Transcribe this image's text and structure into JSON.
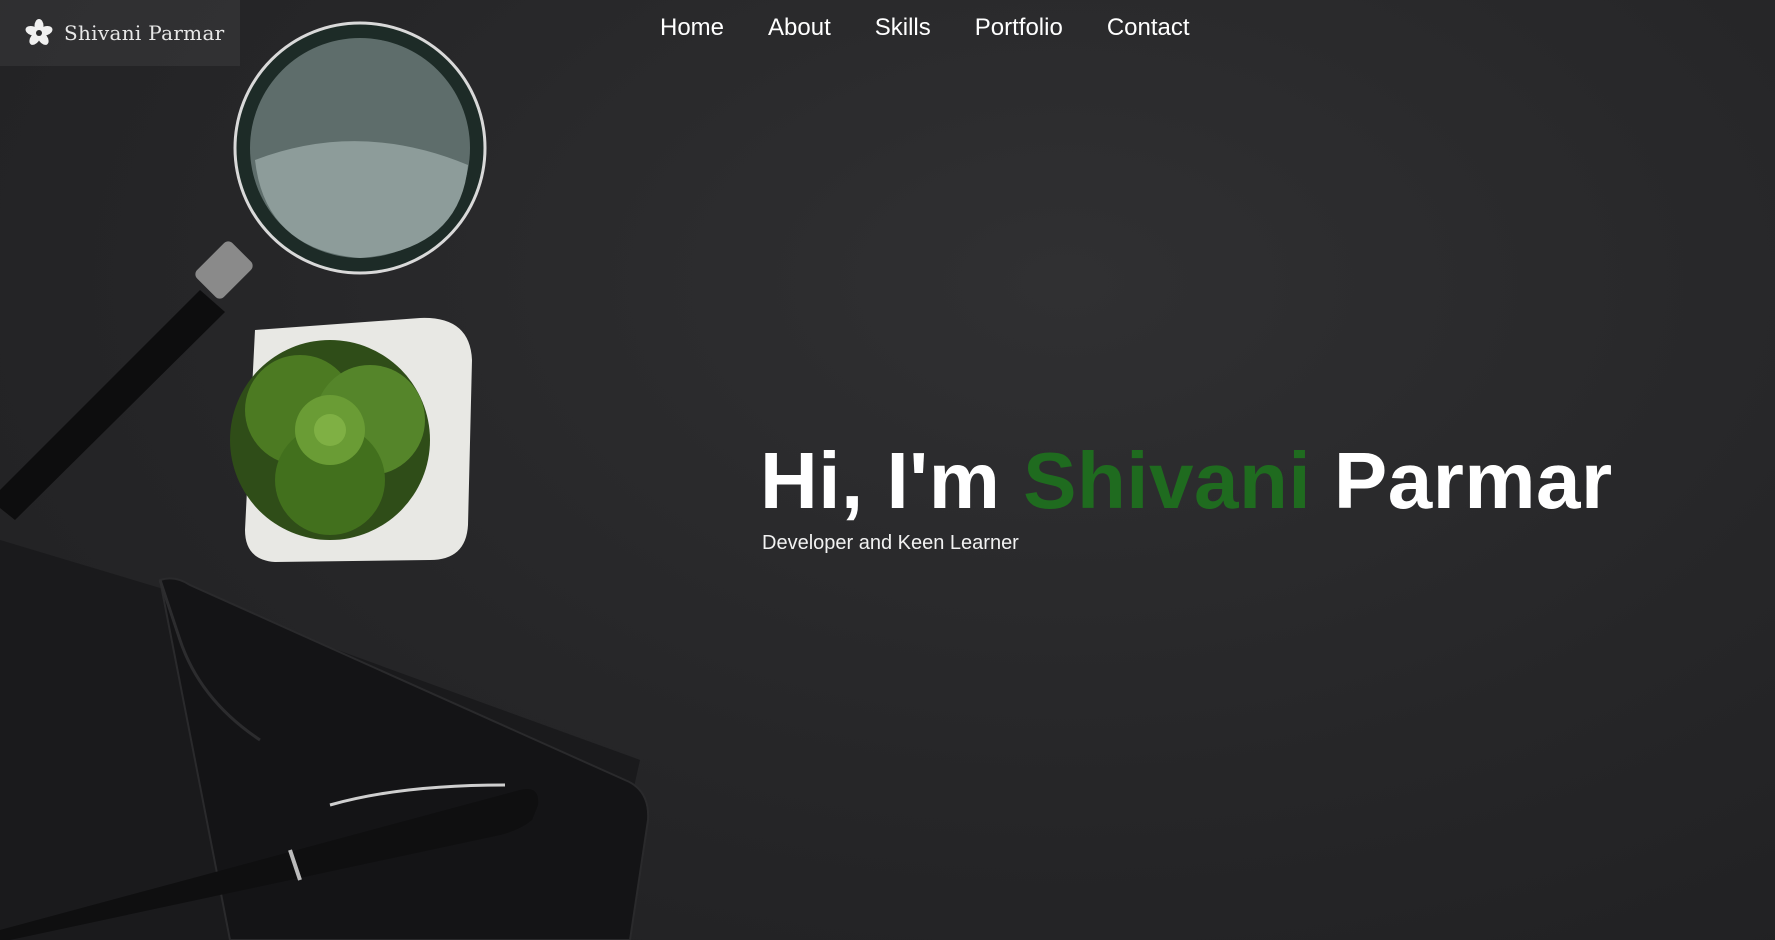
{
  "logo": {
    "text": "Shivani Parmar",
    "icon": "flower-icon"
  },
  "nav": {
    "items": [
      {
        "label": "Home"
      },
      {
        "label": "About"
      },
      {
        "label": "Skills"
      },
      {
        "label": "Portfolio"
      },
      {
        "label": "Contact"
      }
    ]
  },
  "hero": {
    "greeting": "Hi, I'm",
    "first_name": "Shivani",
    "last_name": "Parmar",
    "subtitle": "Developer and Keen Learner"
  },
  "colors": {
    "accent": "#1f6b1f",
    "background": "#262628",
    "text": "#ffffff"
  }
}
